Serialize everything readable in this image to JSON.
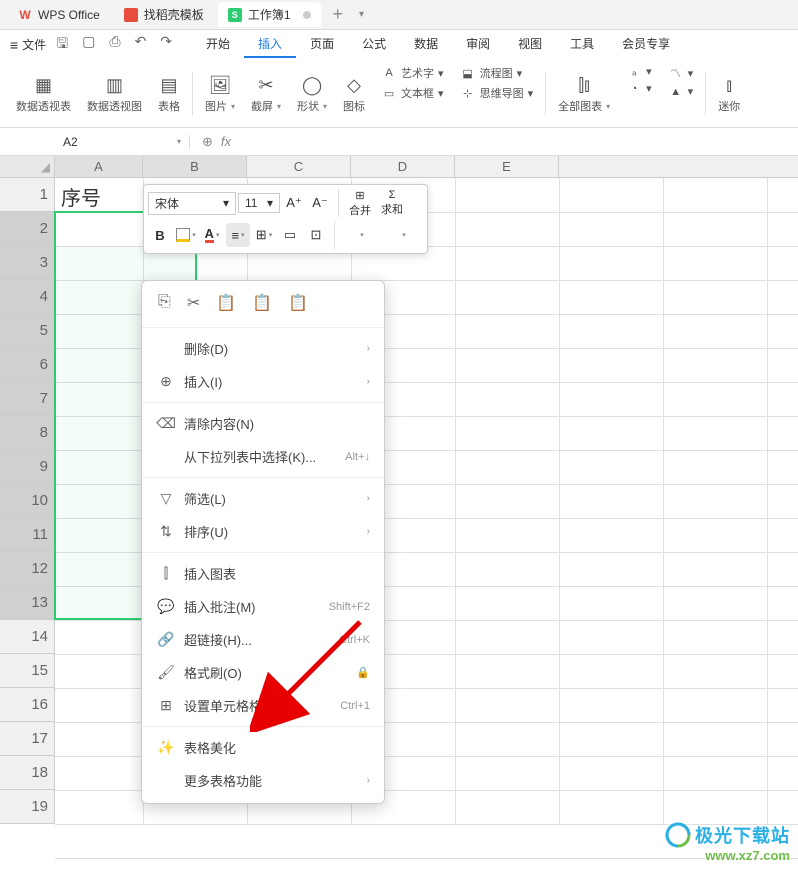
{
  "tabs": {
    "app": "WPS Office",
    "template": "找稻壳模板",
    "workbook": "工作簿1"
  },
  "menu": {
    "file": "文件",
    "items": [
      "开始",
      "插入",
      "页面",
      "公式",
      "数据",
      "审阅",
      "视图",
      "工具",
      "会员专享"
    ],
    "active_index": 1
  },
  "ribbon": {
    "pivot_table": "数据透视表",
    "pivot_chart": "数据透视图",
    "table": "表格",
    "picture": "图片",
    "screenshot": "截屏",
    "shapes": "形状",
    "icons": "图标",
    "wordart": "艺术字",
    "textbox": "文本框",
    "flowchart": "流程图",
    "mindmap": "思维导图",
    "all_charts": "全部图表",
    "mini": "迷你"
  },
  "namebox": "A2",
  "fx_symbol": "fx",
  "columns": [
    "A",
    "B",
    "C",
    "D",
    "E"
  ],
  "rows": [
    "1",
    "2",
    "3",
    "4",
    "5",
    "6",
    "7",
    "8",
    "9",
    "10",
    "11",
    "12",
    "13",
    "14",
    "15",
    "16",
    "17",
    "18",
    "19"
  ],
  "cell_A1": "序号",
  "mini_toolbar": {
    "font": "宋体",
    "size": "11",
    "a_plus": "A⁺",
    "a_minus": "A⁻",
    "bold": "B",
    "merge": "合并",
    "sum": "求和"
  },
  "context_menu": {
    "delete": "删除(D)",
    "insert": "插入(I)",
    "clear": "清除内容(N)",
    "dropdown_pick": "从下拉列表中选择(K)...",
    "dropdown_pick_sc": "Alt+↓",
    "filter": "筛选(L)",
    "sort": "排序(U)",
    "insert_chart": "插入图表",
    "insert_comment": "插入批注(M)",
    "insert_comment_sc": "Shift+F2",
    "hyperlink": "超链接(H)...",
    "hyperlink_sc": "Ctrl+K",
    "format_painter": "格式刷(O)",
    "format_cells": "设置单元格格式(F)...",
    "format_cells_sc": "Ctrl+1",
    "beautify": "表格美化",
    "more": "更多表格功能"
  },
  "watermark": {
    "line1": "极光下载站",
    "line2": "www.xz7.com"
  }
}
